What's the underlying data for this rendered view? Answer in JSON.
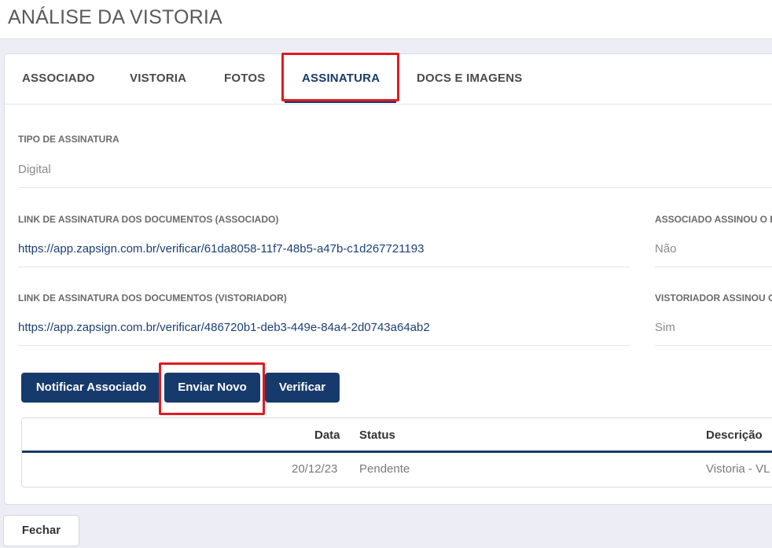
{
  "page": {
    "title": "ANÁLISE DA VISTORIA"
  },
  "tabs": [
    {
      "label": "ASSOCIADO"
    },
    {
      "label": "VISTORIA"
    },
    {
      "label": "FOTOS"
    },
    {
      "label": "ASSINATURA",
      "active": true
    },
    {
      "label": "DOCS E IMAGENS"
    }
  ],
  "signature": {
    "type_label": "TIPO DE ASSINATURA",
    "type_value": "Digital",
    "associate_link_label": "LINK DE ASSINATURA DOS DOCUMENTOS (ASSOCIADO)",
    "associate_link": "https://app.zapsign.com.br/verificar/61da8058-11f7-48b5-a47b-c1d267721193",
    "associate_signed_label": "ASSOCIADO ASSINOU O D",
    "associate_signed_value": "Não",
    "inspector_link_label": "LINK DE ASSINATURA DOS DOCUMENTOS (VISTORIADOR)",
    "inspector_link": "https://app.zapsign.com.br/verificar/486720b1-deb3-449e-84a4-2d0743a64ab2",
    "inspector_signed_label": "VISTORIADOR ASSINOU O",
    "inspector_signed_value": "Sim"
  },
  "actions": {
    "notify_label": "Notificar Associado",
    "resend_label": "Enviar Novo",
    "verify_label": "Verificar"
  },
  "history": {
    "headers": {
      "date": "Data",
      "status": "Status",
      "description": "Descrição"
    },
    "rows": [
      {
        "date": "20/12/23",
        "status": "Pendente",
        "description": "Vistoria - VL"
      }
    ]
  },
  "footer": {
    "close_label": "Fechar"
  },
  "colors": {
    "primary": "#163a6b",
    "highlight": "#e01b22",
    "link": "#1b3f78"
  }
}
